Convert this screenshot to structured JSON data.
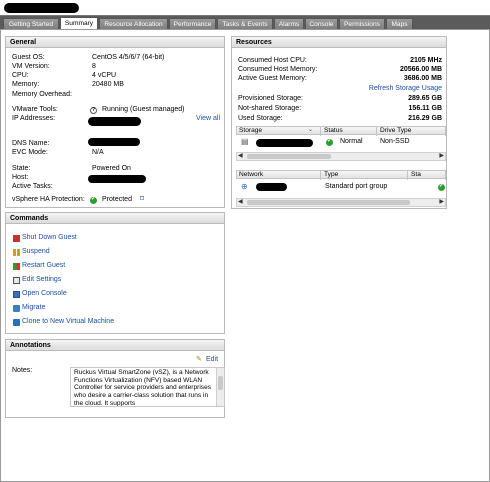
{
  "tabs": [
    {
      "label": "Getting Started"
    },
    {
      "label": "Summary"
    },
    {
      "label": "Resource Allocation"
    },
    {
      "label": "Performance"
    },
    {
      "label": "Tasks & Events"
    },
    {
      "label": "Alarms"
    },
    {
      "label": "Console"
    },
    {
      "label": "Permissions"
    },
    {
      "label": "Maps"
    }
  ],
  "general": {
    "title": "General",
    "guest_os_label": "Guest OS:",
    "guest_os": "CentOS 4/5/6/7 (64-bit)",
    "vm_version_label": "VM Version:",
    "vm_version": "8",
    "cpu_label": "CPU:",
    "cpu": "4 vCPU",
    "memory_label": "Memory:",
    "memory": "20480 MB",
    "memory_overhead_label": "Memory Overhead:",
    "vmware_tools_label": "VMware Tools:",
    "vmware_tools": "Running (Guest managed)",
    "ip_label": "IP Addresses:",
    "view_all": "View all",
    "dns_label": "DNS Name:",
    "evc_label": "EVC Mode:",
    "evc": "N/A",
    "state_label": "State:",
    "state": "Powered On",
    "host_label": "Host:",
    "active_tasks_label": "Active Tasks:",
    "ha_label": "vSphere HA Protection:",
    "ha": "Protected"
  },
  "resources": {
    "title": "Resources",
    "host_cpu_label": "Consumed Host CPU:",
    "host_cpu": "2105 MHz",
    "host_mem_label": "Consumed Host Memory:",
    "host_mem": "20566.00 MB",
    "guest_mem_label": "Active Guest Memory:",
    "guest_mem": "3686.00 MB",
    "refresh_link": "Refresh Storage Usage",
    "prov_label": "Provisioned Storage:",
    "prov": "289.65 GB",
    "notshared_label": "Not-shared Storage:",
    "notshared": "156.11 GB",
    "used_label": "Used Storage:",
    "used": "216.29 GB",
    "storage_table": {
      "headers": [
        "Storage",
        "Status",
        "Drive Type"
      ],
      "row": {
        "status": "Normal",
        "drive_type": "Non-SSD"
      }
    },
    "network_table": {
      "headers": [
        "Network",
        "Type",
        "Sta"
      ],
      "row": {
        "type": "Standard port group"
      }
    }
  },
  "commands": {
    "title": "Commands",
    "items": [
      {
        "label": "Shut Down Guest",
        "icon": "shutdown-icon"
      },
      {
        "label": "Suspend",
        "icon": "suspend-icon"
      },
      {
        "label": "Restart Guest",
        "icon": "restart-icon"
      },
      {
        "label": "Edit Settings",
        "icon": "edit-settings-icon"
      },
      {
        "label": "Open Console",
        "icon": "console-icon"
      },
      {
        "label": "Migrate",
        "icon": "migrate-icon"
      },
      {
        "label": "Clone to New Virtual Machine",
        "icon": "clone-icon"
      }
    ]
  },
  "annotations": {
    "title": "Annotations",
    "edit": "Edit",
    "notes_label": "Notes:",
    "notes": "Ruckus Virtual SmartZone (vSZ), is a Network Functions Virtualization (NFV) based WLAN Controller for service providers and enterprises who desire a carrier-class solution that runs in the cloud. It supports"
  },
  "colors": {
    "tabbar": "#5b5b5b",
    "link": "#1a4fa8",
    "ok": "#2aa12e"
  }
}
